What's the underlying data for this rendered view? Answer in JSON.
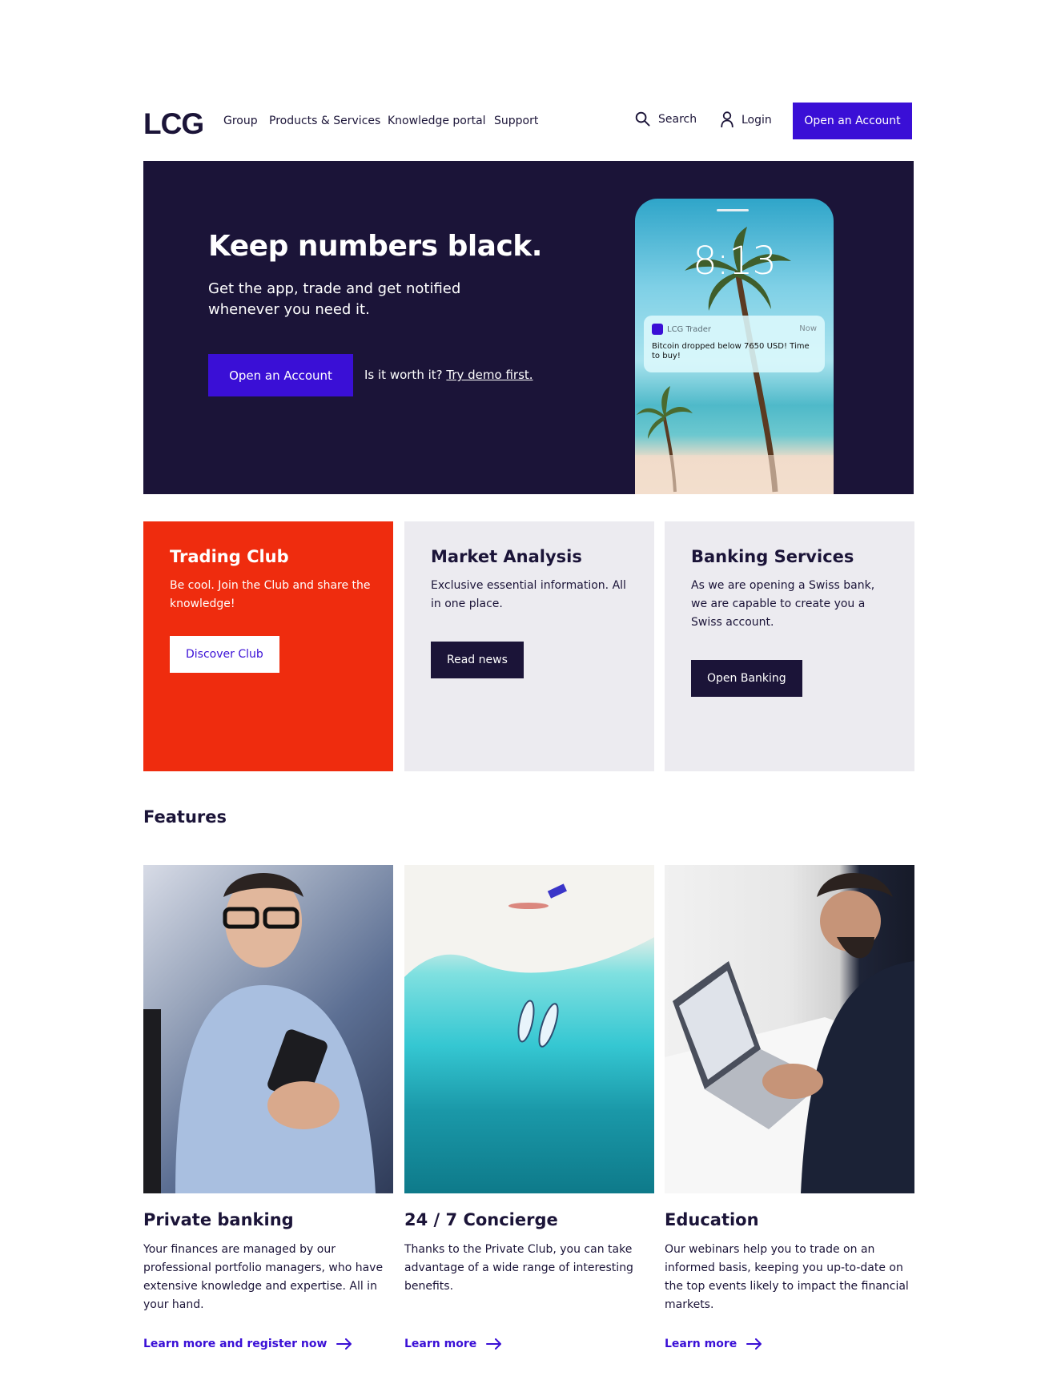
{
  "header": {
    "logo": "LCG",
    "nav": [
      "Group",
      "Products & Services",
      "Knowledge portal",
      "Support"
    ],
    "search_label": "Search",
    "login_label": "Login",
    "cta_label": "Open an Account"
  },
  "hero": {
    "title": "Keep numbers black.",
    "subtitle": "Get the app, trade and get notified whenever you need it.",
    "cta_label": "Open an Account",
    "demo_prefix": "Is it worth it?",
    "demo_link": "Try demo first.",
    "phone": {
      "time": "8:13",
      "notification_app": "LCG Trader",
      "notification_time": "Now",
      "notification_message": "Bitcoin dropped below 7650 USD! Time to buy!"
    }
  },
  "cards": [
    {
      "title": "Trading Club",
      "text": "Be cool. Join the Club and share the knowledge!",
      "button": "Discover Club",
      "color": "#ef2c0e"
    },
    {
      "title": "Market Analysis",
      "text": "Exclusive essential information. All in one place.",
      "button": "Read news",
      "color": "#ecebf0"
    },
    {
      "title": "Banking Services",
      "text": "As we are opening a Swiss bank, we are capable to create you a Swiss account.",
      "button": "Open Banking",
      "color": "#ecebf0"
    }
  ],
  "features": {
    "heading": "Features",
    "items": [
      {
        "title": "Private banking",
        "text": "Your finances are managed by our professional portfolio managers, who have extensive knowledge and expertise. All in your hand.",
        "link": "Learn more and register now"
      },
      {
        "title": "24 / 7 Concierge",
        "text": "Thanks to the Private Club, you can take advantage of a wide range of interesting benefits.",
        "link": "Learn more"
      },
      {
        "title": "Education",
        "text": "Our webinars help you to trade on an informed basis, keeping you up-to-date on the top events likely to impact the financial markets.",
        "link": "Learn more"
      }
    ]
  },
  "colors": {
    "brand": "#3a0fd6",
    "dark": "#1b1438",
    "accent_red": "#ef2c0e",
    "card_gray": "#ecebf0"
  }
}
